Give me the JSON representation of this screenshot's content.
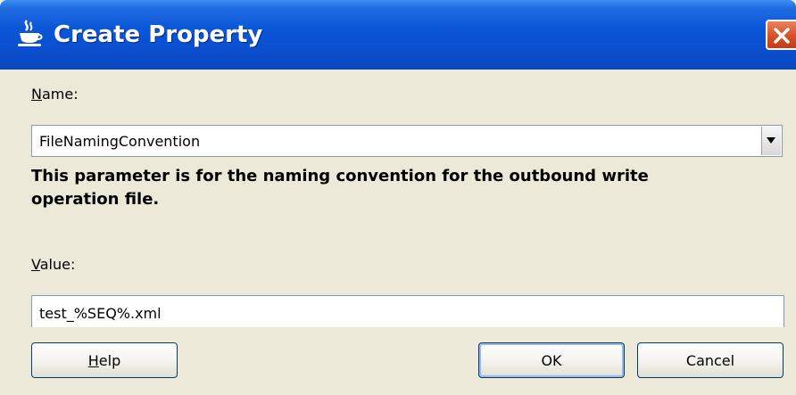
{
  "dialog": {
    "title": "Create Property",
    "close_icon": "close-icon",
    "app_icon": "java-cup-icon"
  },
  "name_field": {
    "label_mnemonic": "N",
    "label_rest": "ame:",
    "value": "FileNamingConvention"
  },
  "description": "This parameter is for the naming convention for the outbound write operation file.",
  "value_field": {
    "label_mnemonic": "V",
    "label_rest": "alue:",
    "value": "test_%SEQ%.xml"
  },
  "buttons": {
    "help_mnemonic": "H",
    "help_rest": "elp",
    "ok": "OK",
    "cancel": "Cancel"
  },
  "colors": {
    "titlebar": "#0a4fd0",
    "body": "#ece9d8",
    "close": "#d9542c"
  }
}
